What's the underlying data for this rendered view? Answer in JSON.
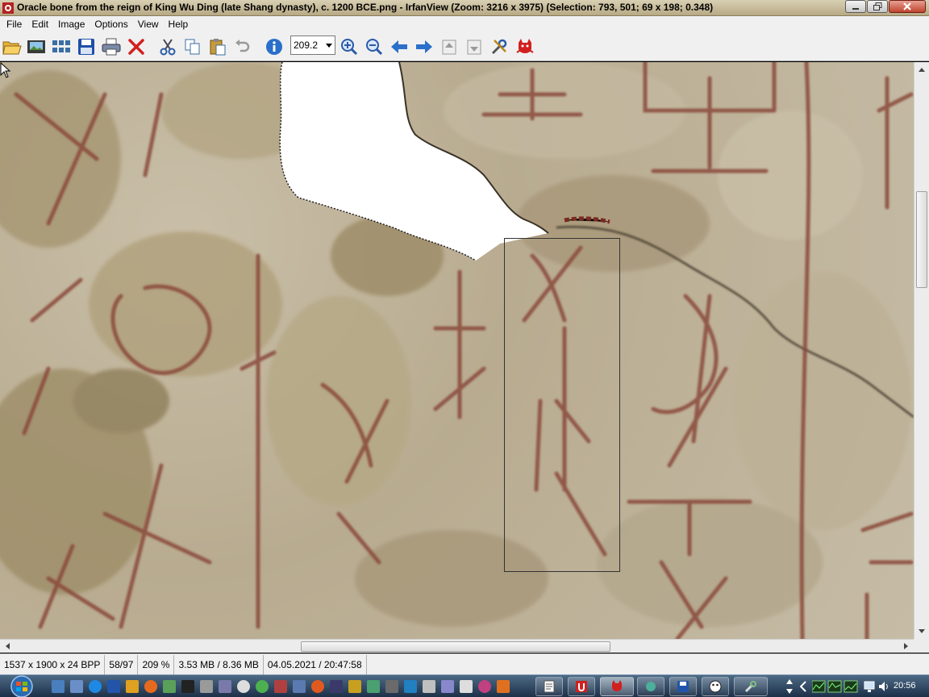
{
  "window": {
    "title": "Oracle bone from the reign of King Wu Ding (late Shang dynasty), c. 1200 BCE.png - IrfanView (Zoom: 3216 x 3975) (Selection: 793, 501; 69 x 198; 0.348)"
  },
  "menu": {
    "file": "File",
    "edit": "Edit",
    "image": "Image",
    "options": "Options",
    "view": "View",
    "help": "Help"
  },
  "toolbar": {
    "zoom_value": "209.2",
    "icons": [
      "open-folder-icon",
      "slideshow-icon",
      "thumbnails-icon",
      "save-icon",
      "print-icon",
      "delete-icon",
      "cut-icon",
      "copy-icon",
      "paste-icon",
      "undo-icon",
      "info-icon",
      "zoom-in-icon",
      "zoom-out-icon",
      "previous-icon",
      "next-icon",
      "page-up-icon",
      "page-down-icon",
      "settings-icon",
      "irfanview-cat-icon"
    ]
  },
  "status": {
    "dimensions": "1537 x 1900 x 24 BPP",
    "index": "58/97",
    "zoom": "209 %",
    "memory": "3.53 MB / 8.36 MB",
    "datetime": "04.05.2021 / 20:47:58"
  },
  "taskbar": {
    "clock": "20:56",
    "colors": {
      "bar_top": "#4d6a86",
      "bar_bottom": "#1d3048"
    }
  },
  "colors": {
    "ink": "#8a4a3a",
    "bone": "#c6bca6",
    "selection_border": "#333333"
  }
}
